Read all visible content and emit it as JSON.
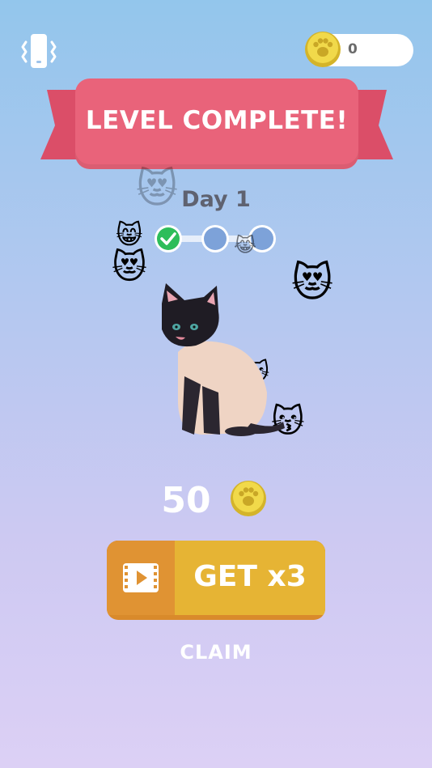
{
  "topbar": {
    "vibrate_icon": "phone-vibrate-icon",
    "coin_icon": "paw-coin-icon",
    "coin_count": "0"
  },
  "banner": {
    "title": "LEVEL COMPLETE!",
    "color": "#e9637a"
  },
  "day": {
    "label": "Day 1",
    "progress_steps": [
      {
        "state": "completed"
      },
      {
        "state": "pending"
      },
      {
        "state": "pending"
      }
    ]
  },
  "reward": {
    "amount": "50",
    "coin_icon": "paw-coin-icon"
  },
  "buttons": {
    "get_x3_label": "GET x3",
    "get_x3_icon": "video-ad-icon",
    "claim_label": "CLAIM"
  },
  "emojis": [
    "😸",
    "😻",
    "😻",
    "😽",
    "😹",
    "🐱"
  ],
  "colors": {
    "accent_orange": "#e6b434",
    "check_green": "#2dbd5a",
    "step_blue": "#7da2d9"
  }
}
